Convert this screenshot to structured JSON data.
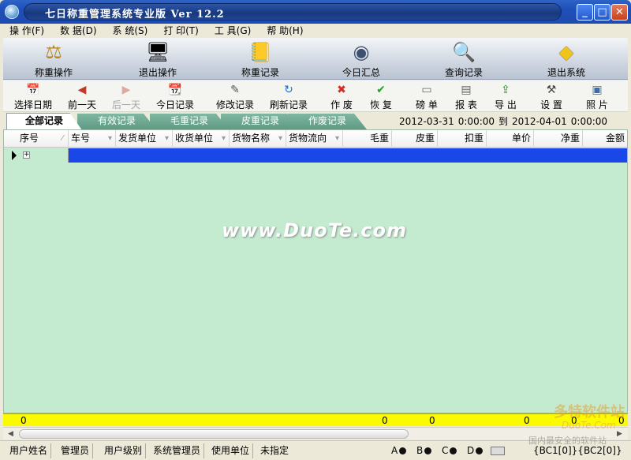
{
  "window": {
    "title": "七日称重管理系统专业版 Ver 12.2",
    "minimize": "_",
    "maximize": "□",
    "close": "✕"
  },
  "menu": [
    "操 作(F)",
    "数 据(D)",
    "系 统(S)",
    "打 印(T)",
    "工 具(G)",
    "帮 助(H)"
  ],
  "toolbar": [
    {
      "label": "称重操作",
      "icon": "scale-icon",
      "glyph": "⚖"
    },
    {
      "label": "退出操作",
      "icon": "monitor-icon",
      "glyph": "🖥"
    },
    {
      "label": "称重记录",
      "icon": "notebook-icon",
      "glyph": "📒"
    },
    {
      "label": "今日汇总",
      "icon": "disc-icon",
      "glyph": "◉"
    },
    {
      "label": "查询记录",
      "icon": "magnifier-icon",
      "glyph": "🔍"
    },
    {
      "label": "退出系统",
      "icon": "exit-sign-icon",
      "glyph": "◆"
    }
  ],
  "actions": [
    {
      "label": "选择日期",
      "icon": "calendar-icon",
      "glyph": "📅",
      "enabled": true
    },
    {
      "label": "前一天",
      "icon": "prev-day-icon",
      "glyph": "◀",
      "enabled": true
    },
    {
      "label": "后一天",
      "icon": "next-day-icon",
      "glyph": "▶",
      "enabled": false
    },
    {
      "label": "今日记录",
      "icon": "today-icon",
      "glyph": "📆",
      "enabled": true
    },
    {
      "label": "修改记录",
      "icon": "edit-icon",
      "glyph": "✎",
      "enabled": true
    },
    {
      "label": "刷新记录",
      "icon": "refresh-icon",
      "glyph": "↻",
      "enabled": true
    },
    {
      "label": "作 废",
      "icon": "void-icon",
      "glyph": "✖",
      "enabled": true
    },
    {
      "label": "恢 复",
      "icon": "restore-icon",
      "glyph": "✔",
      "enabled": true
    },
    {
      "label": "磅 单",
      "icon": "ticket-icon",
      "glyph": "▭",
      "enabled": true
    },
    {
      "label": "报 表",
      "icon": "report-icon",
      "glyph": "▤",
      "enabled": true
    },
    {
      "label": "导 出",
      "icon": "export-icon",
      "glyph": "⇪",
      "enabled": true
    },
    {
      "label": "设 置",
      "icon": "settings-icon",
      "glyph": "⚒",
      "enabled": true
    },
    {
      "label": "照 片",
      "icon": "photo-icon",
      "glyph": "▣",
      "enabled": true
    }
  ],
  "tabs": [
    "全部记录",
    "有效记录",
    "毛重记录",
    "皮重记录",
    "作废记录"
  ],
  "date_range": {
    "start": "2012-03-31",
    "start_time": "0:00:00",
    "to": "到",
    "end": "2012-04-01",
    "end_time": "0:00:00"
  },
  "columns": [
    "序号",
    "车号",
    "发货单位",
    "收货单位",
    "货物名称",
    "货物流向",
    "毛重",
    "皮重",
    "扣重",
    "单价",
    "净重",
    "金额"
  ],
  "watermark": "www.DuoTe.com",
  "totals": {
    "seq": "0",
    "gross": "0",
    "tare": "0",
    "unit_price": "0",
    "net": "0",
    "amount": "0"
  },
  "status": {
    "user_name_label": "用户姓名",
    "user_name": "管理员",
    "user_level_label": "用户级别",
    "user_level": "系统管理员",
    "unit_label": "使用单位",
    "unit": "未指定",
    "led_a": "A",
    "led_b": "B",
    "led_c": "C",
    "led_d": "D",
    "bc": "{BC1[0]}{BC2[0]}"
  },
  "brand_watermark": {
    "name": "多特软件站",
    "url": "DuoTe.Com",
    "slogan": "国内最安全的软件站"
  },
  "colors": {
    "title_bar": "#1f4bb0",
    "grid_bg": "#c4ebd0",
    "selected_row": "#1a48e8",
    "totals_row": "#fbfb00",
    "tab_bg": "#6aa691"
  }
}
